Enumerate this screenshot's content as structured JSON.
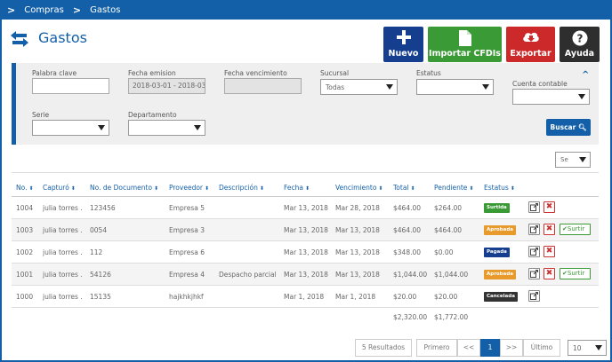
{
  "breadcrumb": {
    "items": [
      "Compras",
      "Gastos"
    ]
  },
  "page": {
    "title": "Gastos"
  },
  "actions": {
    "nuevo": "Nuevo",
    "importar": "Importar CFDIs",
    "exportar": "Exportar",
    "ayuda": "Ayuda"
  },
  "filters": {
    "palabra_clave": {
      "label": "Palabra clave",
      "value": ""
    },
    "fecha_emision": {
      "label": "Fecha emision",
      "value": "2018-03-01 - 2018-03-"
    },
    "fecha_vencimiento": {
      "label": "Fecha vencimiento",
      "value": ""
    },
    "sucursal": {
      "label": "Sucursal",
      "value": "Todas"
    },
    "estatus": {
      "label": "Estatus",
      "value": ""
    },
    "cuenta_contable": {
      "label": "Cuenta contable",
      "value": ""
    },
    "serie": {
      "label": "Serie",
      "value": ""
    },
    "departamento": {
      "label": "Departamento",
      "value": ""
    },
    "buscar_label": "Buscar"
  },
  "column_select": {
    "value": "Se"
  },
  "table": {
    "headers": [
      "No.",
      "Capturó",
      "No. de Documento",
      "Proveedor",
      "Descripción",
      "Fecha",
      "Vencimiento",
      "Total",
      "Pendiente",
      "Estatus"
    ],
    "rows": [
      {
        "no": "1004",
        "capturo": "julia torres .",
        "documento": "123456",
        "proveedor": "Empresa 5",
        "descripcion": "",
        "fecha": "Mar 13, 2018",
        "vencimiento": "Mar 28, 2018",
        "total": "$464.00",
        "pendiente": "$264.00",
        "estatus": "Surtida",
        "surtir": ""
      },
      {
        "no": "1003",
        "capturo": "julia torres .",
        "documento": "0054",
        "proveedor": "Empresa 3",
        "descripcion": "",
        "fecha": "Mar 13, 2018",
        "vencimiento": "Mar 13, 2018",
        "total": "$464.00",
        "pendiente": "$464.00",
        "estatus": "Aprobada",
        "surtir": "Surtir"
      },
      {
        "no": "1002",
        "capturo": "julia torres .",
        "documento": "112",
        "proveedor": "Empresa 6",
        "descripcion": "",
        "fecha": "Mar 13, 2018",
        "vencimiento": "Mar 13, 2018",
        "total": "$348.00",
        "pendiente": "$0.00",
        "estatus": "Pagada",
        "surtir": ""
      },
      {
        "no": "1001",
        "capturo": "julia torres .",
        "documento": "54126",
        "proveedor": "Empresa 4",
        "descripcion": "Despacho parcial",
        "fecha": "Mar 13, 2018",
        "vencimiento": "Mar 13, 2018",
        "total": "$1,044.00",
        "pendiente": "$1,044.00",
        "estatus": "Aprobada",
        "surtir": "Surtir"
      },
      {
        "no": "1000",
        "capturo": "julia torres .",
        "documento": "15135",
        "proveedor": "hajkhkjhkf",
        "descripcion": "",
        "fecha": "Mar 1, 2018",
        "vencimiento": "Mar 1, 2018",
        "total": "$20.00",
        "pendiente": "$20.00",
        "estatus": "Cancelada",
        "surtir": ""
      }
    ],
    "totals": {
      "total": "$2,320.00",
      "pendiente": "$1,772.00"
    }
  },
  "pagination": {
    "results": "5 Resultados",
    "first": "Primero",
    "prev": "<<",
    "current": "1",
    "next": ">>",
    "last": "Último",
    "per_page": "10"
  },
  "colors": {
    "brand": "#1460a8",
    "nuevo": "#153e8f",
    "importar": "#3a9a35",
    "exportar": "#cc2a2a",
    "ayuda": "#2e2e2e"
  }
}
